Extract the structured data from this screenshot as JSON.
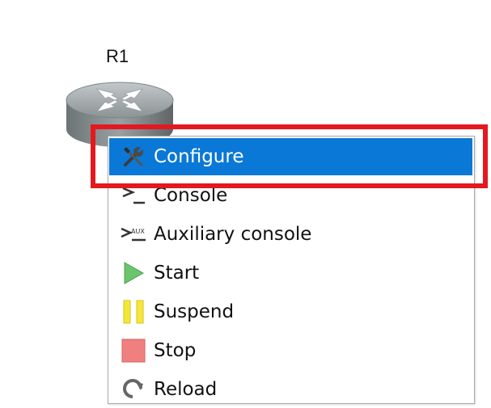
{
  "node": {
    "label": "R1",
    "icon": "router-icon"
  },
  "context_menu": {
    "items": [
      {
        "label": "Configure",
        "icon": "wrench-screwdriver-icon",
        "highlighted": true
      },
      {
        "label": "Console",
        "icon": "console-icon"
      },
      {
        "label": "Auxiliary console",
        "icon": "aux-console-icon"
      },
      {
        "label": "Start",
        "icon": "start-icon"
      },
      {
        "label": "Suspend",
        "icon": "suspend-icon"
      },
      {
        "label": "Stop",
        "icon": "stop-icon"
      },
      {
        "label": "Reload",
        "icon": "reload-icon"
      }
    ],
    "aux_icon_text": "AUX"
  },
  "colors": {
    "highlight_bg": "#0a78d7",
    "annotation_box": "#e3191f",
    "start": "#6cc46c",
    "suspend": "#f5e63a",
    "stop": "#f08080"
  }
}
